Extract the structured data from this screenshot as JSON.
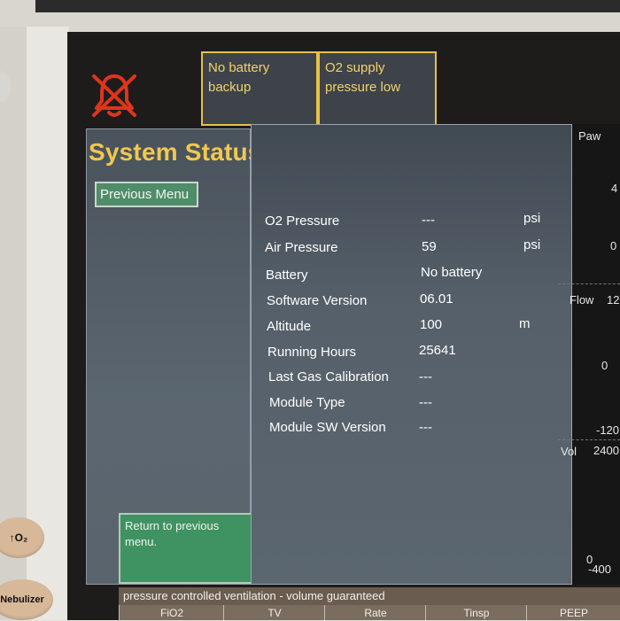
{
  "device": {
    "o2_button_label": "↑O₂",
    "nebulizer_button_label": "Nebulizer"
  },
  "alarms": {
    "silence_icon": "alarm-silenced-icon",
    "messages": [
      "No battery backup",
      "O2 supply pressure low"
    ]
  },
  "screen": {
    "title": "System Status",
    "previous_menu_label": "Previous Menu",
    "help_text": "Return to previous menu."
  },
  "status_rows": [
    {
      "label": "O2 Pressure",
      "value": "---",
      "unit": "psi"
    },
    {
      "label": "Air Pressure",
      "value": "59",
      "unit": "psi"
    },
    {
      "label": "Battery",
      "value": "No battery",
      "unit": ""
    },
    {
      "label": "Software Version",
      "value": "06.01",
      "unit": ""
    },
    {
      "label": "Altitude",
      "value": "100",
      "unit": "m"
    },
    {
      "label": "Running Hours",
      "value": "25641",
      "unit": ""
    },
    {
      "label": "Last Gas Calibration",
      "value": "---",
      "unit": ""
    },
    {
      "label": "Module Type",
      "value": "---",
      "unit": ""
    },
    {
      "label": "Module SW Version",
      "value": "---",
      "unit": ""
    }
  ],
  "waveforms": {
    "paw_label": "Paw",
    "paw_values": [
      "4",
      "0"
    ],
    "flow_label": "Flow",
    "flow_values": [
      "12",
      "0",
      "-120"
    ],
    "vol_label": "Vol",
    "vol_values": [
      "2400",
      "0",
      "-400"
    ]
  },
  "mode_text": "pressure controlled ventilation - volume guaranteed",
  "parameters": [
    "FiO2",
    "TV",
    "Rate",
    "Tinsp",
    "PEEP"
  ],
  "colors": {
    "alarm_accent": "#e7c046",
    "title": "#f1c84f",
    "button_green": "#4f8d69",
    "alarm_icon": "#e0341c"
  }
}
